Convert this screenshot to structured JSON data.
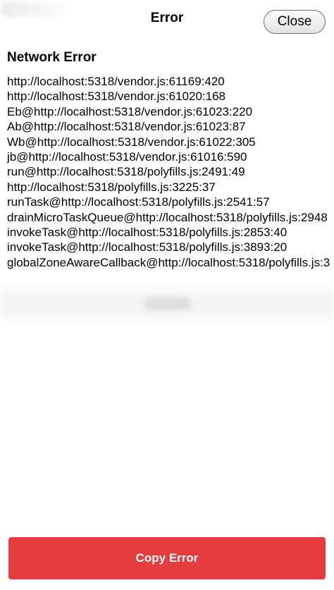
{
  "header": {
    "title": "Error",
    "close_label": "Close"
  },
  "error": {
    "heading": "Network Error",
    "stack": [
      "http://localhost:5318/vendor.js:61169:420",
      "http://localhost:5318/vendor.js:61020:168",
      "Eb@http://localhost:5318/vendor.js:61023:220",
      "Ab@http://localhost:5318/vendor.js:61023:87",
      "Wb@http://localhost:5318/vendor.js:61022:305",
      "jb@http://localhost:5318/vendor.js:61016:590",
      "run@http://localhost:5318/polyfills.js:2491:49",
      "http://localhost:5318/polyfills.js:3225:37",
      "runTask@http://localhost:5318/polyfills.js:2541:57",
      "drainMicroTaskQueue@http://localhost:5318/polyfills.js:2948",
      "invokeTask@http://localhost:5318/polyfills.js:2853:40",
      "invokeTask@http://localhost:5318/polyfills.js:3893:20",
      "globalZoneAwareCallback@http://localhost:5318/polyfills.js:3"
    ]
  },
  "footer": {
    "copy_label": "Copy Error"
  },
  "colors": {
    "accent_red": "#e53c3f",
    "background": "#ffffff"
  }
}
